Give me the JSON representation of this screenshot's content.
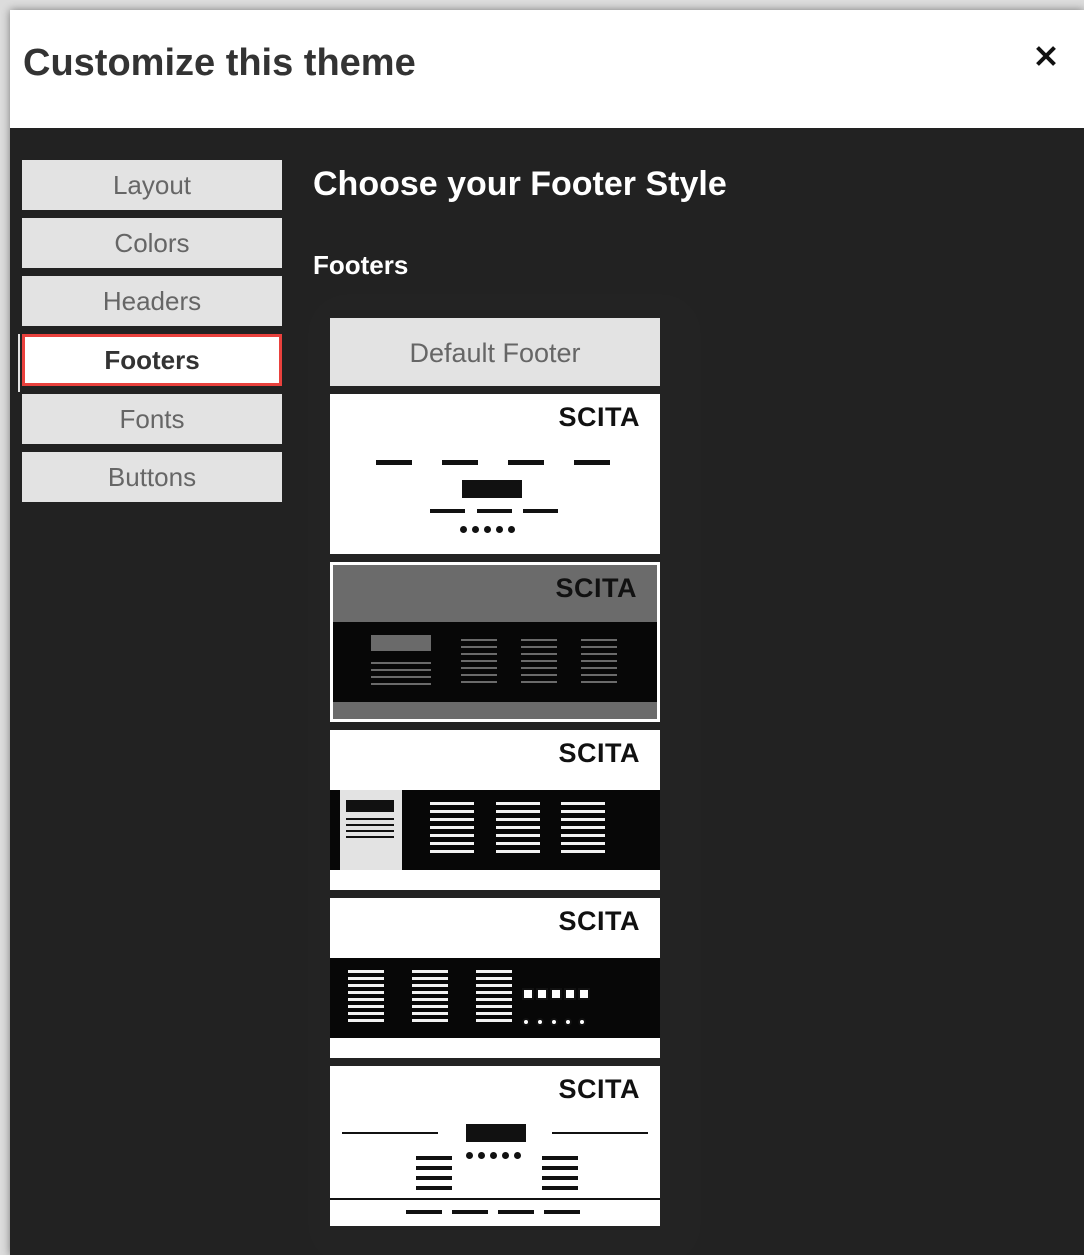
{
  "dialog": {
    "title": "Customize this theme"
  },
  "nav": {
    "items": [
      {
        "label": "Layout"
      },
      {
        "label": "Colors"
      },
      {
        "label": "Headers"
      },
      {
        "label": "Footers",
        "active": true
      },
      {
        "label": "Fonts"
      },
      {
        "label": "Buttons"
      }
    ]
  },
  "main": {
    "heading": "Choose your Footer Style",
    "subheading": "Footers",
    "default_footer": "Default Footer",
    "thumb_brand": "SCITA"
  },
  "colors": {
    "accent": "#e9413d",
    "panel_bg": "#222222",
    "button_bg": "#e3e3e3"
  }
}
